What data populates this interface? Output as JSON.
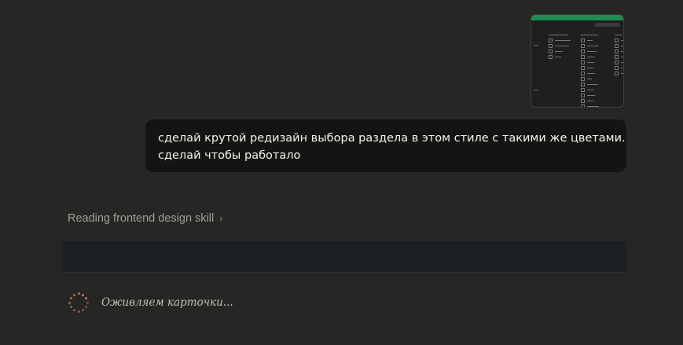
{
  "attachment": {
    "kind": "screenshot",
    "accent_color": "#1f8c53"
  },
  "user_message": {
    "line1": "сделай крутой редизайн выбора раздела в этом стиле с такими же цветами.",
    "line2": "сделай чтобы работало"
  },
  "skill": {
    "label": "Reading frontend design skill",
    "chevron": "›"
  },
  "status": {
    "text": "Оживляем карточки...",
    "spinner_color": "#d97757"
  },
  "colors": {
    "background": "#262624",
    "bubble": "#141413",
    "panel": "#1c2024"
  }
}
